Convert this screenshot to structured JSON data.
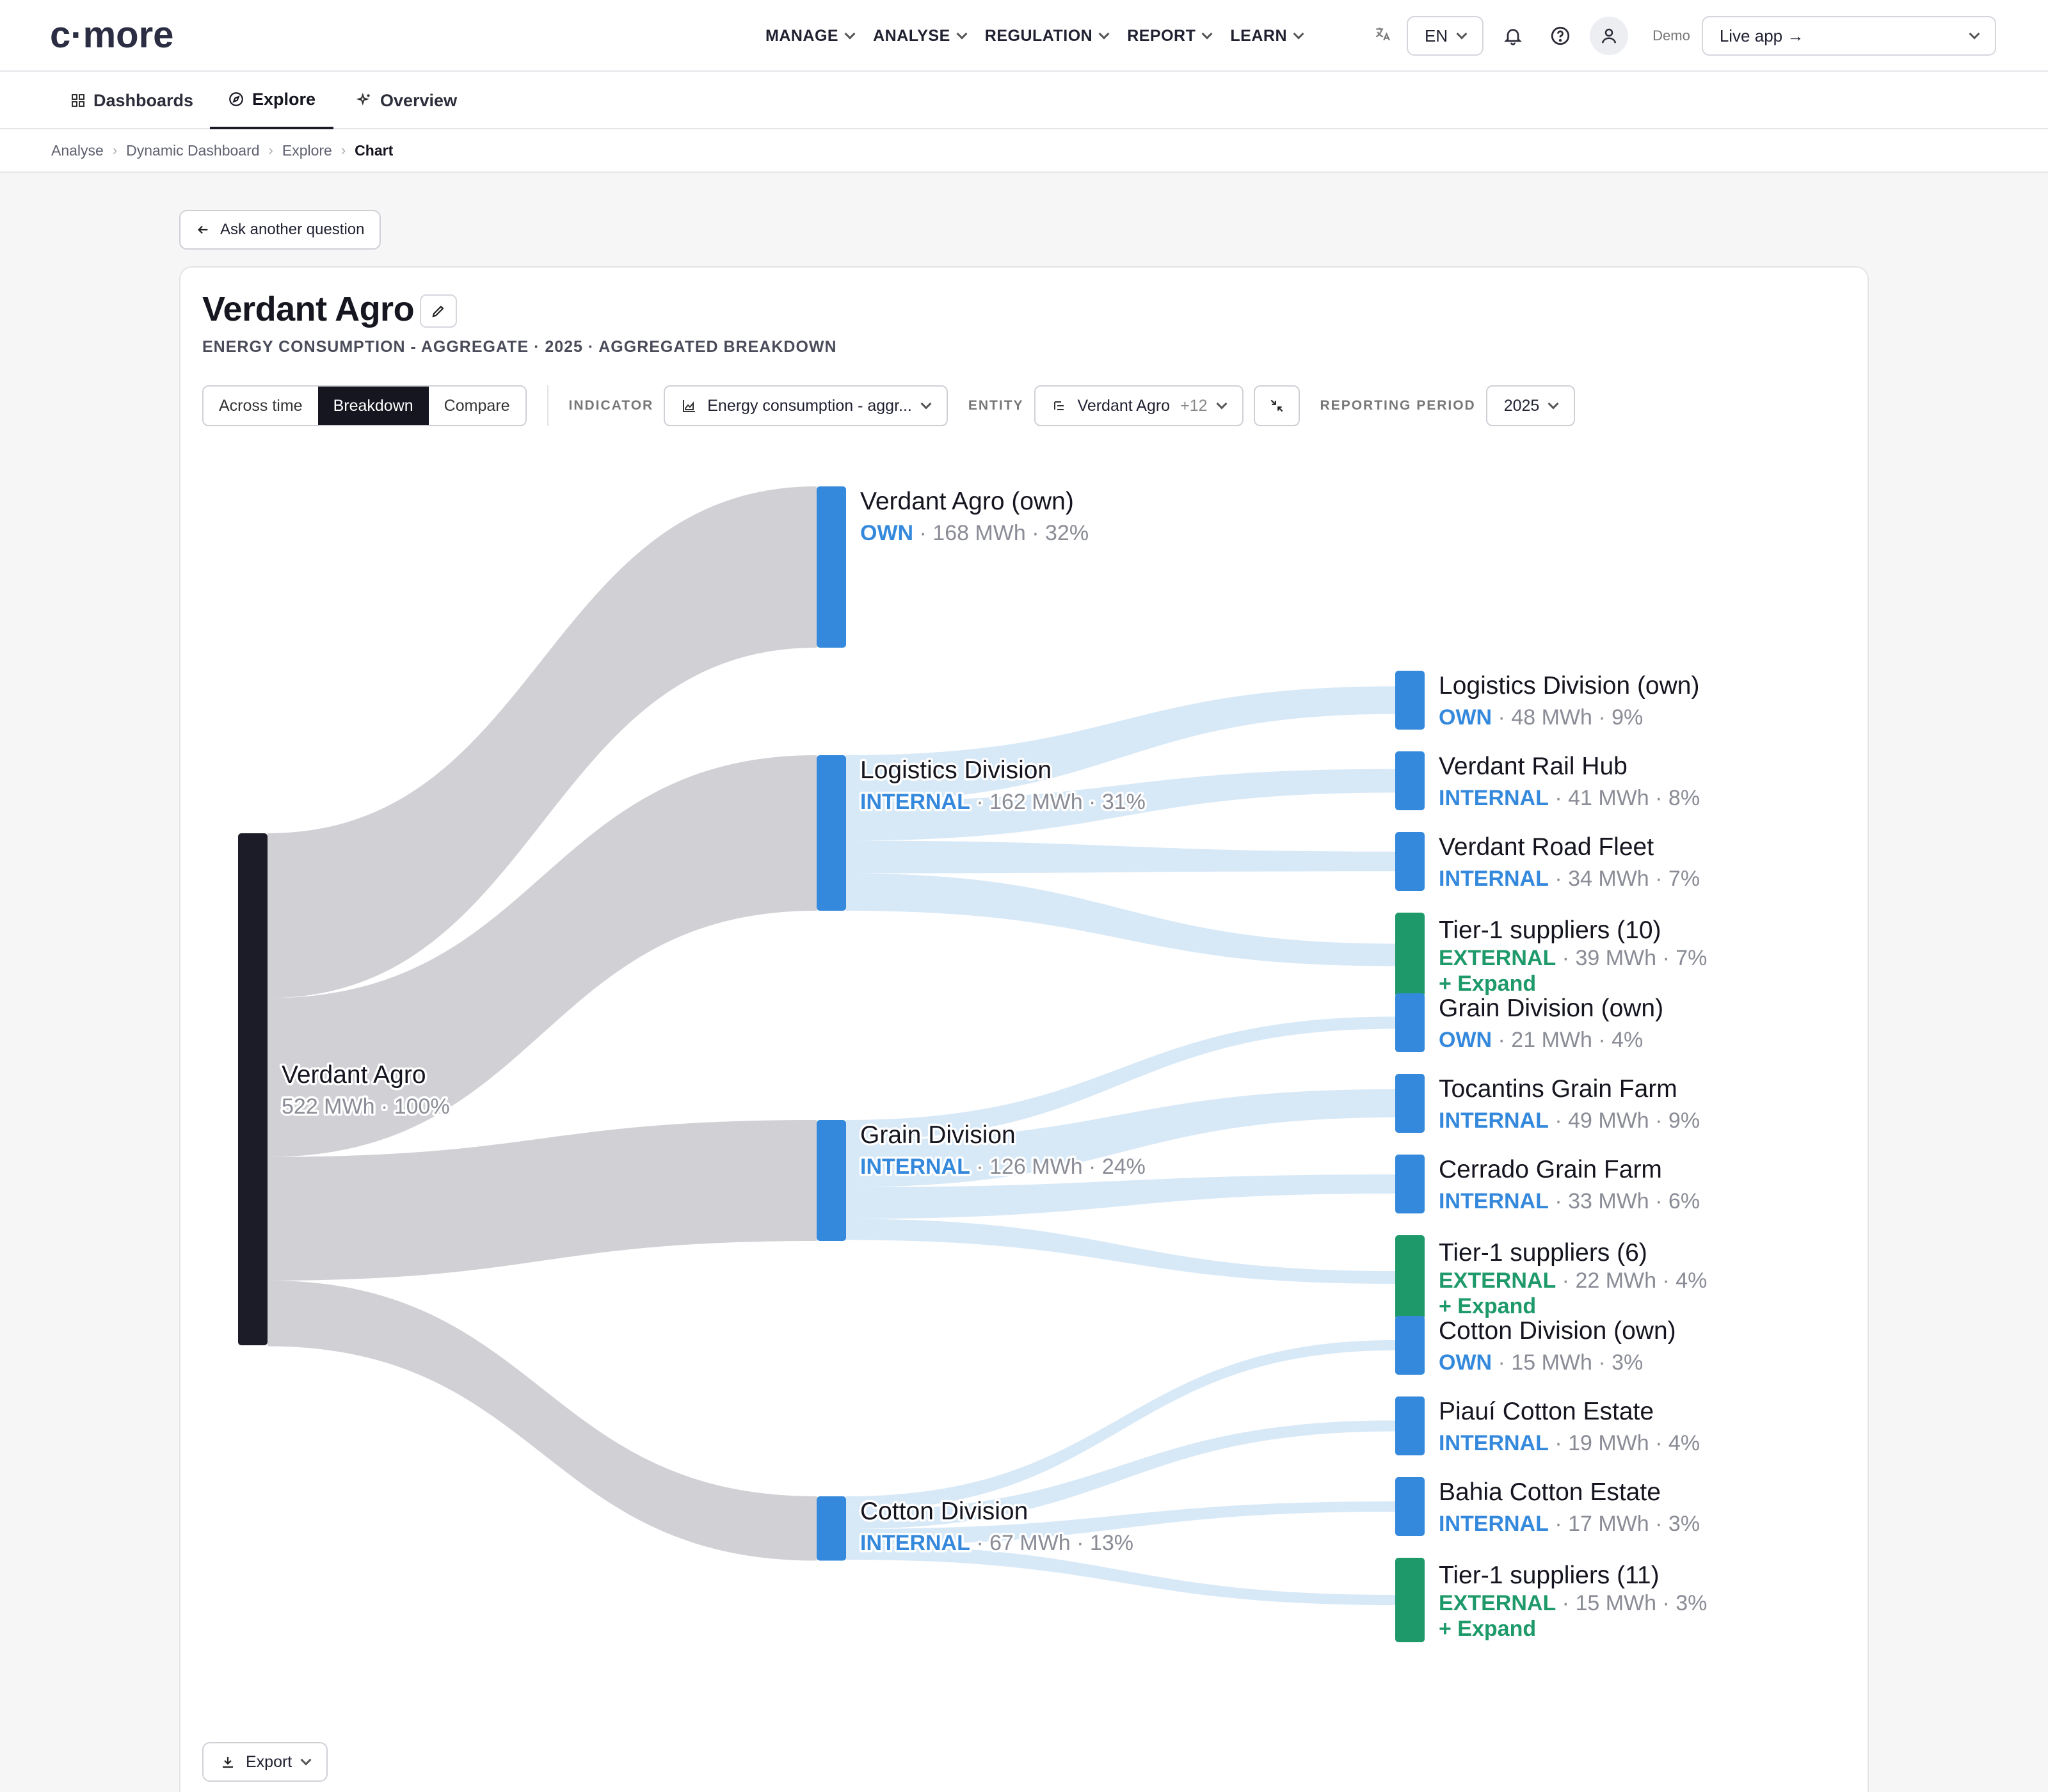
{
  "app": {
    "logo_text": "c·more"
  },
  "nav": {
    "items": [
      {
        "label": "MANAGE"
      },
      {
        "label": "ANALYSE"
      },
      {
        "label": "REGULATION"
      },
      {
        "label": "REPORT"
      },
      {
        "label": "LEARN"
      }
    ],
    "language": "EN",
    "demo_label": "Demo",
    "app_select": "Live app →"
  },
  "subnav": {
    "tabs": [
      {
        "label": "Dashboards"
      },
      {
        "label": "Explore"
      },
      {
        "label": "Overview"
      }
    ]
  },
  "breadcrumb": [
    "Analyse",
    "Dynamic Dashboard",
    "Explore",
    "Chart"
  ],
  "ask_button": "Ask another question",
  "card": {
    "title": "Verdant Agro",
    "subtitle": "ENERGY CONSUMPTION - AGGREGATE · 2025 · AGGREGATED BREAKDOWN",
    "view_modes": [
      "Across time",
      "Breakdown",
      "Compare"
    ],
    "indicator_label": "INDICATOR",
    "indicator_value": "Energy consumption - aggr...",
    "entity_label": "ENTITY",
    "entity_value": "Verdant Agro",
    "entity_extra": "+12",
    "period_label": "REPORTING PERIOD",
    "period_value": "2025",
    "export_label": "Export"
  },
  "colors": {
    "root": "#1b1c28",
    "own_internal": "#3589dc",
    "external": "#1e9a6a",
    "link_root": "#cdced3",
    "link_child": "#d3e5f6"
  },
  "chart_data": {
    "type": "sankey",
    "unit": "MWh",
    "expand_label": "+ Expand",
    "nodes": [
      {
        "id": "root",
        "name": "Verdant Agro",
        "value": 522,
        "pct": "100%"
      },
      {
        "id": "own",
        "name": "Verdant Agro (own)",
        "tag": "OWN",
        "value": 168,
        "pct": "32%",
        "parent": "root"
      },
      {
        "id": "log",
        "name": "Logistics Division",
        "tag": "INTERNAL",
        "value": 162,
        "pct": "31%",
        "parent": "root"
      },
      {
        "id": "grain",
        "name": "Grain Division",
        "tag": "INTERNAL",
        "value": 126,
        "pct": "24%",
        "parent": "root"
      },
      {
        "id": "cotton",
        "name": "Cotton Division",
        "tag": "INTERNAL",
        "value": 67,
        "pct": "13%",
        "parent": "root"
      },
      {
        "id": "log_own",
        "name": "Logistics Division (own)",
        "tag": "OWN",
        "value": 48,
        "pct": "9%",
        "parent": "log"
      },
      {
        "id": "rail",
        "name": "Verdant Rail Hub",
        "tag": "INTERNAL",
        "value": 41,
        "pct": "8%",
        "parent": "log"
      },
      {
        "id": "road",
        "name": "Verdant Road Fleet",
        "tag": "INTERNAL",
        "value": 34,
        "pct": "7%",
        "parent": "log"
      },
      {
        "id": "t1a",
        "name": "Tier-1 suppliers (10)",
        "tag": "EXTERNAL",
        "value": 39,
        "pct": "7%",
        "parent": "log",
        "expand": true
      },
      {
        "id": "grain_own",
        "name": "Grain Division (own)",
        "tag": "OWN",
        "value": 21,
        "pct": "4%",
        "parent": "grain"
      },
      {
        "id": "toc",
        "name": "Tocantins Grain Farm",
        "tag": "INTERNAL",
        "value": 49,
        "pct": "9%",
        "parent": "grain"
      },
      {
        "id": "cer",
        "name": "Cerrado Grain Farm",
        "tag": "INTERNAL",
        "value": 33,
        "pct": "6%",
        "parent": "grain"
      },
      {
        "id": "t1b",
        "name": "Tier-1 suppliers (6)",
        "tag": "EXTERNAL",
        "value": 22,
        "pct": "4%",
        "parent": "grain",
        "expand": true
      },
      {
        "id": "cot_own",
        "name": "Cotton Division (own)",
        "tag": "OWN",
        "value": 15,
        "pct": "3%",
        "parent": "cotton"
      },
      {
        "id": "piaui",
        "name": "Piauí Cotton Estate",
        "tag": "INTERNAL",
        "value": 19,
        "pct": "4%",
        "parent": "cotton"
      },
      {
        "id": "bahia",
        "name": "Bahia Cotton Estate",
        "tag": "INTERNAL",
        "value": 17,
        "pct": "3%",
        "parent": "cotton"
      },
      {
        "id": "t1c",
        "name": "Tier-1 suppliers (11)",
        "tag": "EXTERNAL",
        "value": 15,
        "pct": "3%",
        "parent": "cotton",
        "expand": true
      }
    ]
  }
}
